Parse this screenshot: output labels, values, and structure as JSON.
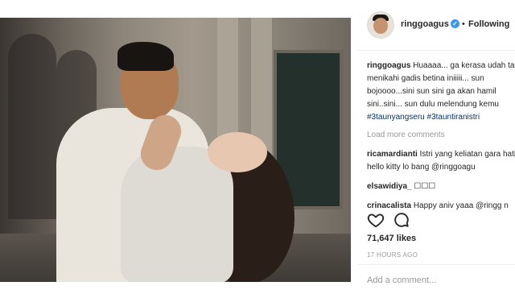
{
  "header": {
    "username": "ringgoagus",
    "separator": "•",
    "follow_label": "Following",
    "verified_mark": "✓"
  },
  "caption": {
    "username": "ringgoagus",
    "text": "Huaaaa... ga kerasa udah taun menikahi gadis betina iniiiii... sun bojoooo...sini sun sini ga akan hamil sini..sini... sun dulu melendung kemu",
    "hashtags": "#3taunyangseru #3tauntiranistri"
  },
  "load_more_label": "Load more comments",
  "comments": [
    {
      "username": "ricamardianti",
      "text": "Istri yang keliatan gara hati_ hello kitty lo bang @ringgoagu"
    },
    {
      "username": "elsawidiya_",
      "text": "☐☐☐"
    },
    {
      "username": "crinacalista",
      "text": "Happy aniv yaaa @ringg n @sabaidieter ... hebring keluarga n"
    }
  ],
  "actions": {
    "like_icon": "heart-outline-icon",
    "comment_icon": "comment-bubble-icon"
  },
  "likes_text": "71,647 likes",
  "timestamp": "17 HOURS AGO",
  "add_comment_placeholder": "Add a comment...",
  "colors": {
    "verified_blue": "#3897f0",
    "hashtag": "#003569",
    "muted": "#999999",
    "text": "#262626"
  }
}
